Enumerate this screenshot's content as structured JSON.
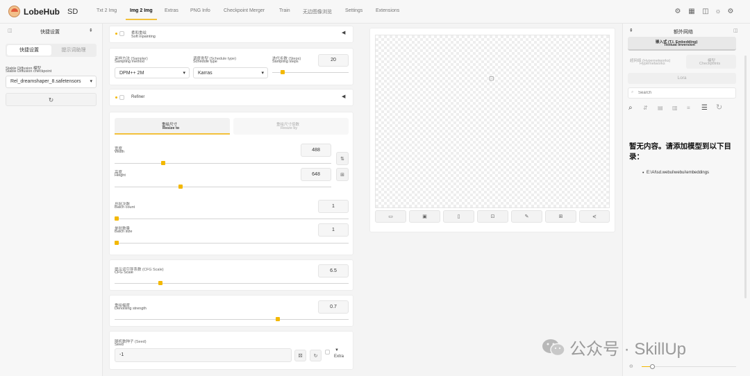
{
  "header": {
    "app_name": "LobeHub",
    "app_suffix": "SD",
    "tabs": [
      "Txt 2 Img",
      "Img 2 Img",
      "Extras",
      "PNG Info",
      "Checkpoint Merger",
      "Train",
      "无边图像浏览",
      "Settings",
      "Extensions"
    ],
    "active_tab": "Img 2 Img"
  },
  "left_panel": {
    "title": "快捷设置",
    "tabs": [
      "快捷设置",
      "提示词助理"
    ],
    "checkpoint_label_cn": "Stable Diffusion 模型",
    "checkpoint_label_en": "Stable Diffusion checkpoint",
    "checkpoint_value": "Rel_dreamshaper_8.safetensors"
  },
  "soft_inpainting": {
    "cn": "柔和重绘",
    "en": "Soft inpainting"
  },
  "sampling": {
    "method_cn": "采样方法 (Sampler)",
    "method_en": "Sampling method",
    "method_value": "DPM++ 2M",
    "schedule_cn": "调度类型 (Schedule type)",
    "schedule_en": "Schedule type",
    "schedule_value": "Karras",
    "steps_cn": "迭代步数 (Steps)",
    "steps_en": "Sampling steps",
    "steps_value": "20",
    "steps_fraction": 0.12
  },
  "refiner": {
    "label": "Refiner"
  },
  "resize": {
    "tab_resize_to_cn": "重绘尺寸",
    "tab_resize_to_en": "Resize to",
    "tab_resize_by_cn": "重绘尺寸倍数",
    "tab_resize_by_en": "Resize by",
    "width_cn": "宽度",
    "width_en": "Width",
    "width_value": "488",
    "width_fraction": 0.22,
    "height_cn": "高度",
    "height_en": "Height",
    "height_value": "648",
    "height_fraction": 0.3
  },
  "batch": {
    "count_cn": "总批次数",
    "count_en": "Batch count",
    "count_value": "1",
    "count_fraction": 0.0,
    "size_cn": "单批数量",
    "size_en": "Batch size",
    "size_value": "1",
    "size_fraction": 0.0
  },
  "cfg": {
    "cn": "提示词引导系数 (CFG Scale)",
    "en": "CFG Scale",
    "value": "6.5",
    "fraction": 0.19
  },
  "denoise": {
    "cn": "重绘幅度",
    "en": "Denoising strength",
    "value": "0.7",
    "fraction": 0.7
  },
  "seed": {
    "cn": "随机数种子 (Seed)",
    "en": "Seed",
    "value": "-1",
    "extra_label": "Extra"
  },
  "right_panel": {
    "title": "额外网络",
    "tabs": [
      {
        "cn": "嵌入式 (T.I. Embedding)",
        "en": "Textual Inversion"
      },
      {
        "cn": "超网络 (Hypernetworks)",
        "en": "Hypernetworks"
      },
      {
        "cn": "模型",
        "en": "Checkpoints"
      },
      {
        "cn": "",
        "en": "Lora"
      }
    ],
    "search_placeholder": "Search",
    "empty_message": "暂无内容。请添加模型到以下目录：",
    "empty_path": "E:\\AI\\sd.webui\\webui\\embeddings"
  },
  "watermark": "公众号 · SkillUp"
}
